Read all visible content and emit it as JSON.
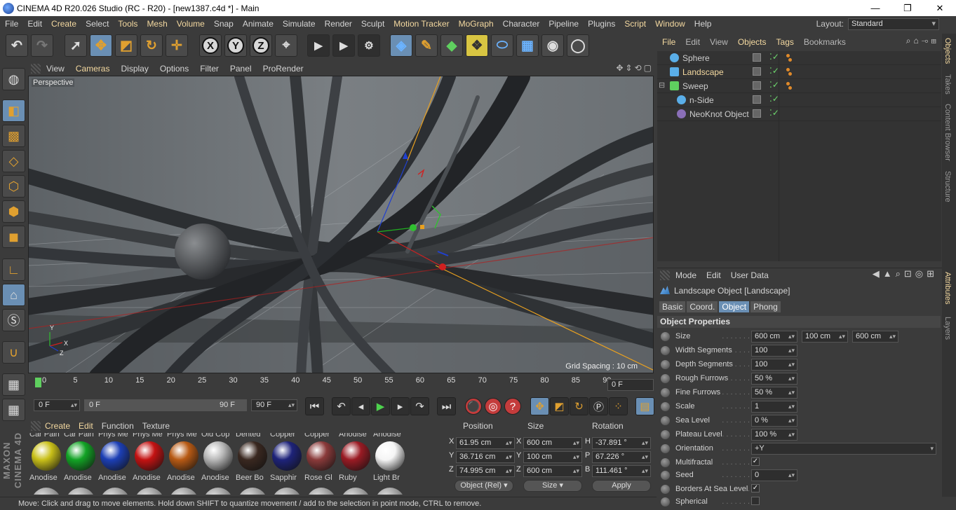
{
  "window": {
    "title": "CINEMA 4D R20.026 Studio (RC - R20) - [new1387.c4d *] - Main",
    "controls": [
      "—",
      "❐",
      "✕"
    ]
  },
  "menubar": {
    "items": [
      "File",
      "Edit",
      "Create",
      "Select",
      "Tools",
      "Mesh",
      "Volume",
      "Snap",
      "Animate",
      "Simulate",
      "Render",
      "Sculpt",
      "Motion Tracker",
      "MoGraph",
      "Character",
      "Pipeline",
      "Plugins",
      "Script",
      "Window",
      "Help"
    ],
    "layout_label": "Layout:",
    "layout_value": "Standard"
  },
  "toolbar": {
    "axis_buttons": [
      "X",
      "Y",
      "Z"
    ]
  },
  "viewport": {
    "menu": [
      "View",
      "Cameras",
      "Display",
      "Options",
      "Filter",
      "Panel",
      "ProRender"
    ],
    "camera_label": "Perspective",
    "grid_spacing": "Grid Spacing : 10 cm",
    "axis_labels": [
      "Y",
      "Z",
      "X"
    ]
  },
  "timeline": {
    "ticks": [
      "0",
      "5",
      "10",
      "15",
      "20",
      "25",
      "30",
      "35",
      "40",
      "45",
      "50",
      "55",
      "60",
      "65",
      "70",
      "75",
      "80",
      "85",
      "90"
    ],
    "current_frame": "0 F",
    "start_field": "0 F",
    "range_start": "0 F",
    "range_end": "90 F",
    "end_field": "90 F"
  },
  "materials": {
    "menu": [
      "Create",
      "Edit",
      "Function",
      "Texture"
    ],
    "top_labels": [
      "Car Pain",
      "Car Pain",
      "Phys Me",
      "Phys Me",
      "Phys Me",
      "Old Cop",
      "Dented",
      "Copper",
      "Copper",
      "Anodise",
      "Anodise"
    ],
    "items": [
      {
        "label": "Anodise",
        "color": "#c9c019"
      },
      {
        "label": "Anodise",
        "color": "#12a325"
      },
      {
        "label": "Anodise",
        "color": "#1c3fb5"
      },
      {
        "label": "Anodise",
        "color": "#c41212"
      },
      {
        "label": "Anodise",
        "color": "#b85a14"
      },
      {
        "label": "Anodise",
        "color": "#b8b8b8"
      },
      {
        "label": "Beer Bo",
        "color": "#3a2820"
      },
      {
        "label": "Sapphir",
        "color": "#1e237a"
      },
      {
        "label": "Rose Gl",
        "color": "#8a3a3a"
      },
      {
        "label": "Ruby",
        "color": "#9a1b24"
      },
      {
        "label": "Light Br",
        "color": "#f5f5f5"
      }
    ]
  },
  "coords": {
    "headers": [
      "Position",
      "Size",
      "Rotation"
    ],
    "rows": [
      {
        "axis": "X",
        "pos": "61.95 cm",
        "saxis": "X",
        "size": "600 cm",
        "raxis": "H",
        "rot": "-37.891 °"
      },
      {
        "axis": "Y",
        "pos": "36.716 cm",
        "saxis": "Y",
        "size": "100 cm",
        "raxis": "P",
        "rot": "67.226 °"
      },
      {
        "axis": "Z",
        "pos": "74.995 cm",
        "saxis": "Z",
        "size": "600 cm",
        "raxis": "B",
        "rot": "111.461 °"
      }
    ],
    "mode": "Object (Rel)",
    "size_mode": "Size",
    "apply": "Apply"
  },
  "status": "Move: Click and drag to move elements. Hold down SHIFT to quantize movement / add to the selection in point mode, CTRL to remove.",
  "objects": {
    "menu": [
      "File",
      "Edit",
      "View",
      "Objects",
      "Tags",
      "Bookmarks"
    ],
    "items": [
      {
        "name": "Sphere",
        "color": "#5aaee8",
        "tag": true
      },
      {
        "name": "Landscape",
        "color": "#5aaee8",
        "tag": true,
        "selected": true
      },
      {
        "name": "Sweep",
        "color": "#5fd05f",
        "tag": true
      },
      {
        "name": "n-Side",
        "color": "#5aaee8",
        "tag": false
      },
      {
        "name": "NeoKnot Object",
        "color": "#8a6fb8",
        "tag": false
      }
    ]
  },
  "side_tabs": [
    "Objects",
    "Takes",
    "Content Browser",
    "Structure",
    "Attributes",
    "Layers"
  ],
  "attributes": {
    "menu": [
      "Mode",
      "Edit",
      "User Data"
    ],
    "title": "Landscape Object [Landscape]",
    "tabs": [
      "Basic",
      "Coord.",
      "Object",
      "Phong"
    ],
    "active_tab": "Object",
    "section": "Object Properties",
    "size": [
      "600 cm",
      "100 cm",
      "600 cm"
    ],
    "props": [
      {
        "label": "Width Segments",
        "value": "100"
      },
      {
        "label": "Depth Segments",
        "value": "100"
      },
      {
        "label": "Rough Furrows",
        "value": "50 %"
      },
      {
        "label": "Fine Furrows",
        "value": "50 %"
      },
      {
        "label": "Scale",
        "value": "1"
      },
      {
        "label": "Sea Level",
        "value": "0 %"
      },
      {
        "label": "Plateau Level",
        "value": "100 %"
      }
    ],
    "size_label": "Size",
    "orientation_label": "Orientation",
    "orientation_value": "+Y",
    "multifractal_label": "Multifractal",
    "seed_label": "Seed",
    "seed_value": "0",
    "borders_label": "Borders At Sea Level",
    "spherical_label": "Spherical"
  }
}
